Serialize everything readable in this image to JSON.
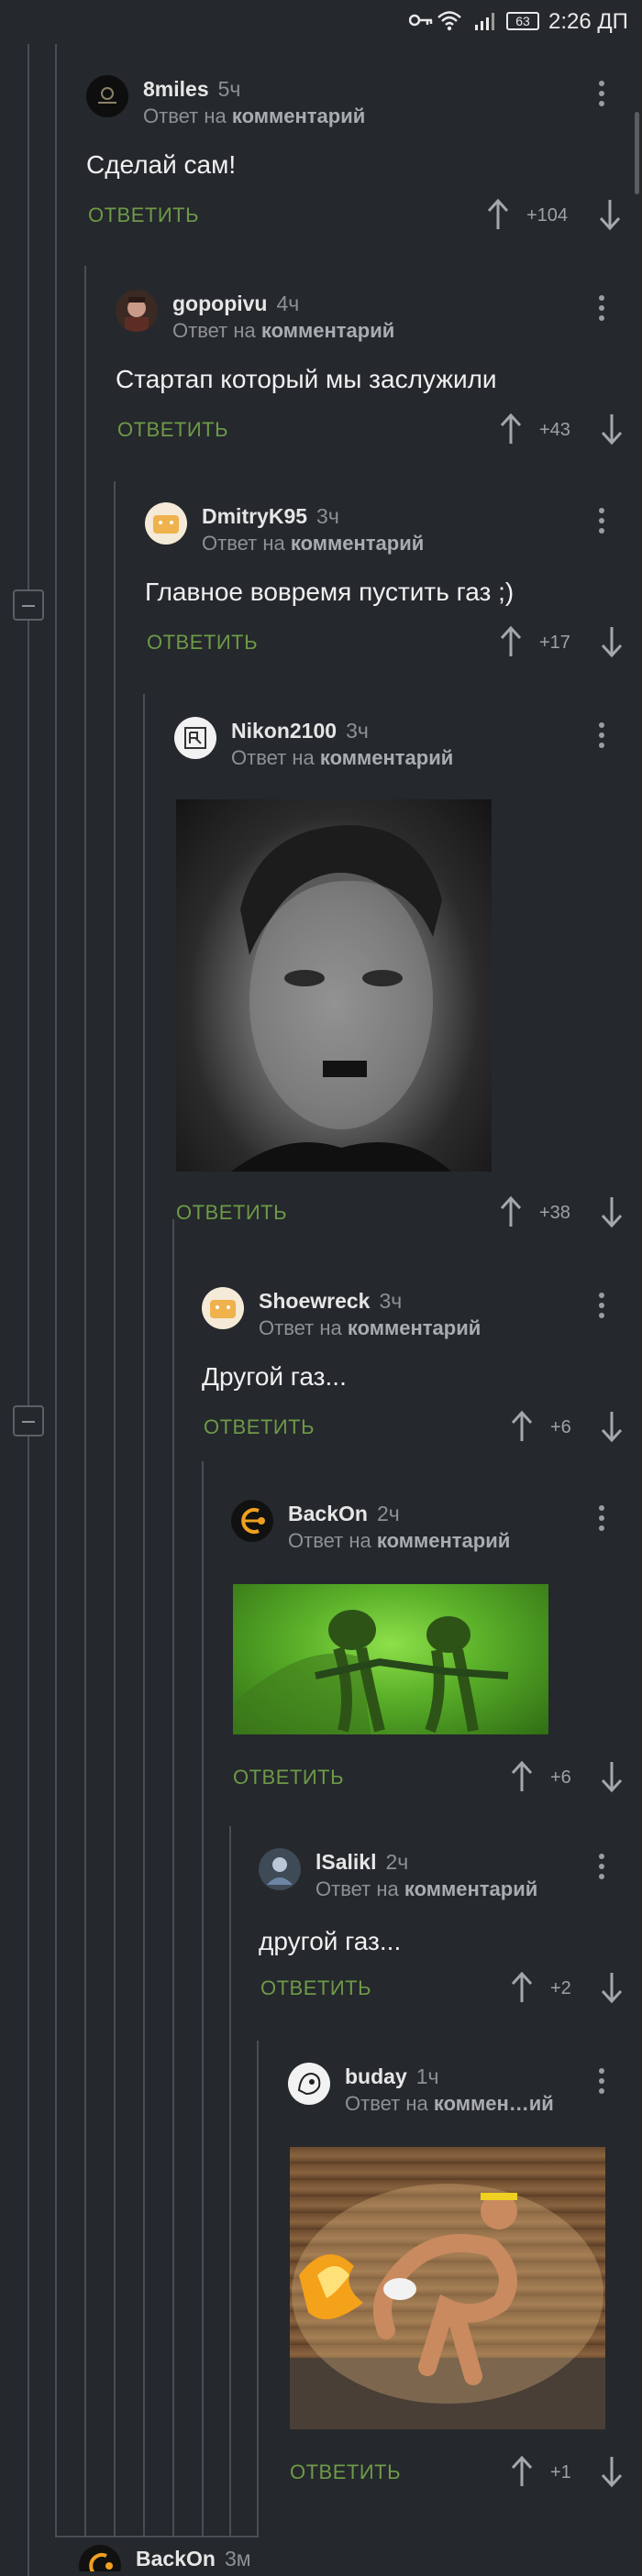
{
  "status_bar": {
    "battery": "63",
    "time": "2:26 ДП"
  },
  "common": {
    "reply_label": "ОТВЕТИТЬ",
    "reply_prefix": "Ответ на",
    "reply_target": "комментарий"
  },
  "comments": [
    {
      "author": "8miles",
      "time": "5ч",
      "text": "Сделай сам!",
      "score": "+104"
    },
    {
      "author": "gopopivu",
      "time": "4ч",
      "text": "Стартап который мы заслужили",
      "score": "+43"
    },
    {
      "author": "DmitryK95",
      "time": "3ч",
      "text": "Главное вовремя пустить газ ;)",
      "score": "+17"
    },
    {
      "author": "Nikon2100",
      "time": "3ч",
      "text": "",
      "score": "+38"
    },
    {
      "author": "Shoewreck",
      "time": "3ч",
      "text": "Другой газ...",
      "score": "+6"
    },
    {
      "author": "BackOn",
      "time": "2ч",
      "text": "",
      "score": "+6"
    },
    {
      "author": "lSalikl",
      "time": "2ч",
      "text": "другой газ...",
      "score": "+2"
    },
    {
      "author": "buday",
      "time": "1ч",
      "text": "",
      "score": "+1",
      "reply_target_short": "коммен…ий"
    },
    {
      "author": "BackOn",
      "time": "3м"
    }
  ],
  "icons": {
    "collapse": "minus-square-icon",
    "more": "kebab-menu-icon",
    "upvote": "arrow-up-icon",
    "downvote": "arrow-down-icon"
  },
  "colors": {
    "background": "#25282c",
    "accent": "#6d9a48",
    "text": "#f0f0f0",
    "muted": "#8d9196"
  }
}
